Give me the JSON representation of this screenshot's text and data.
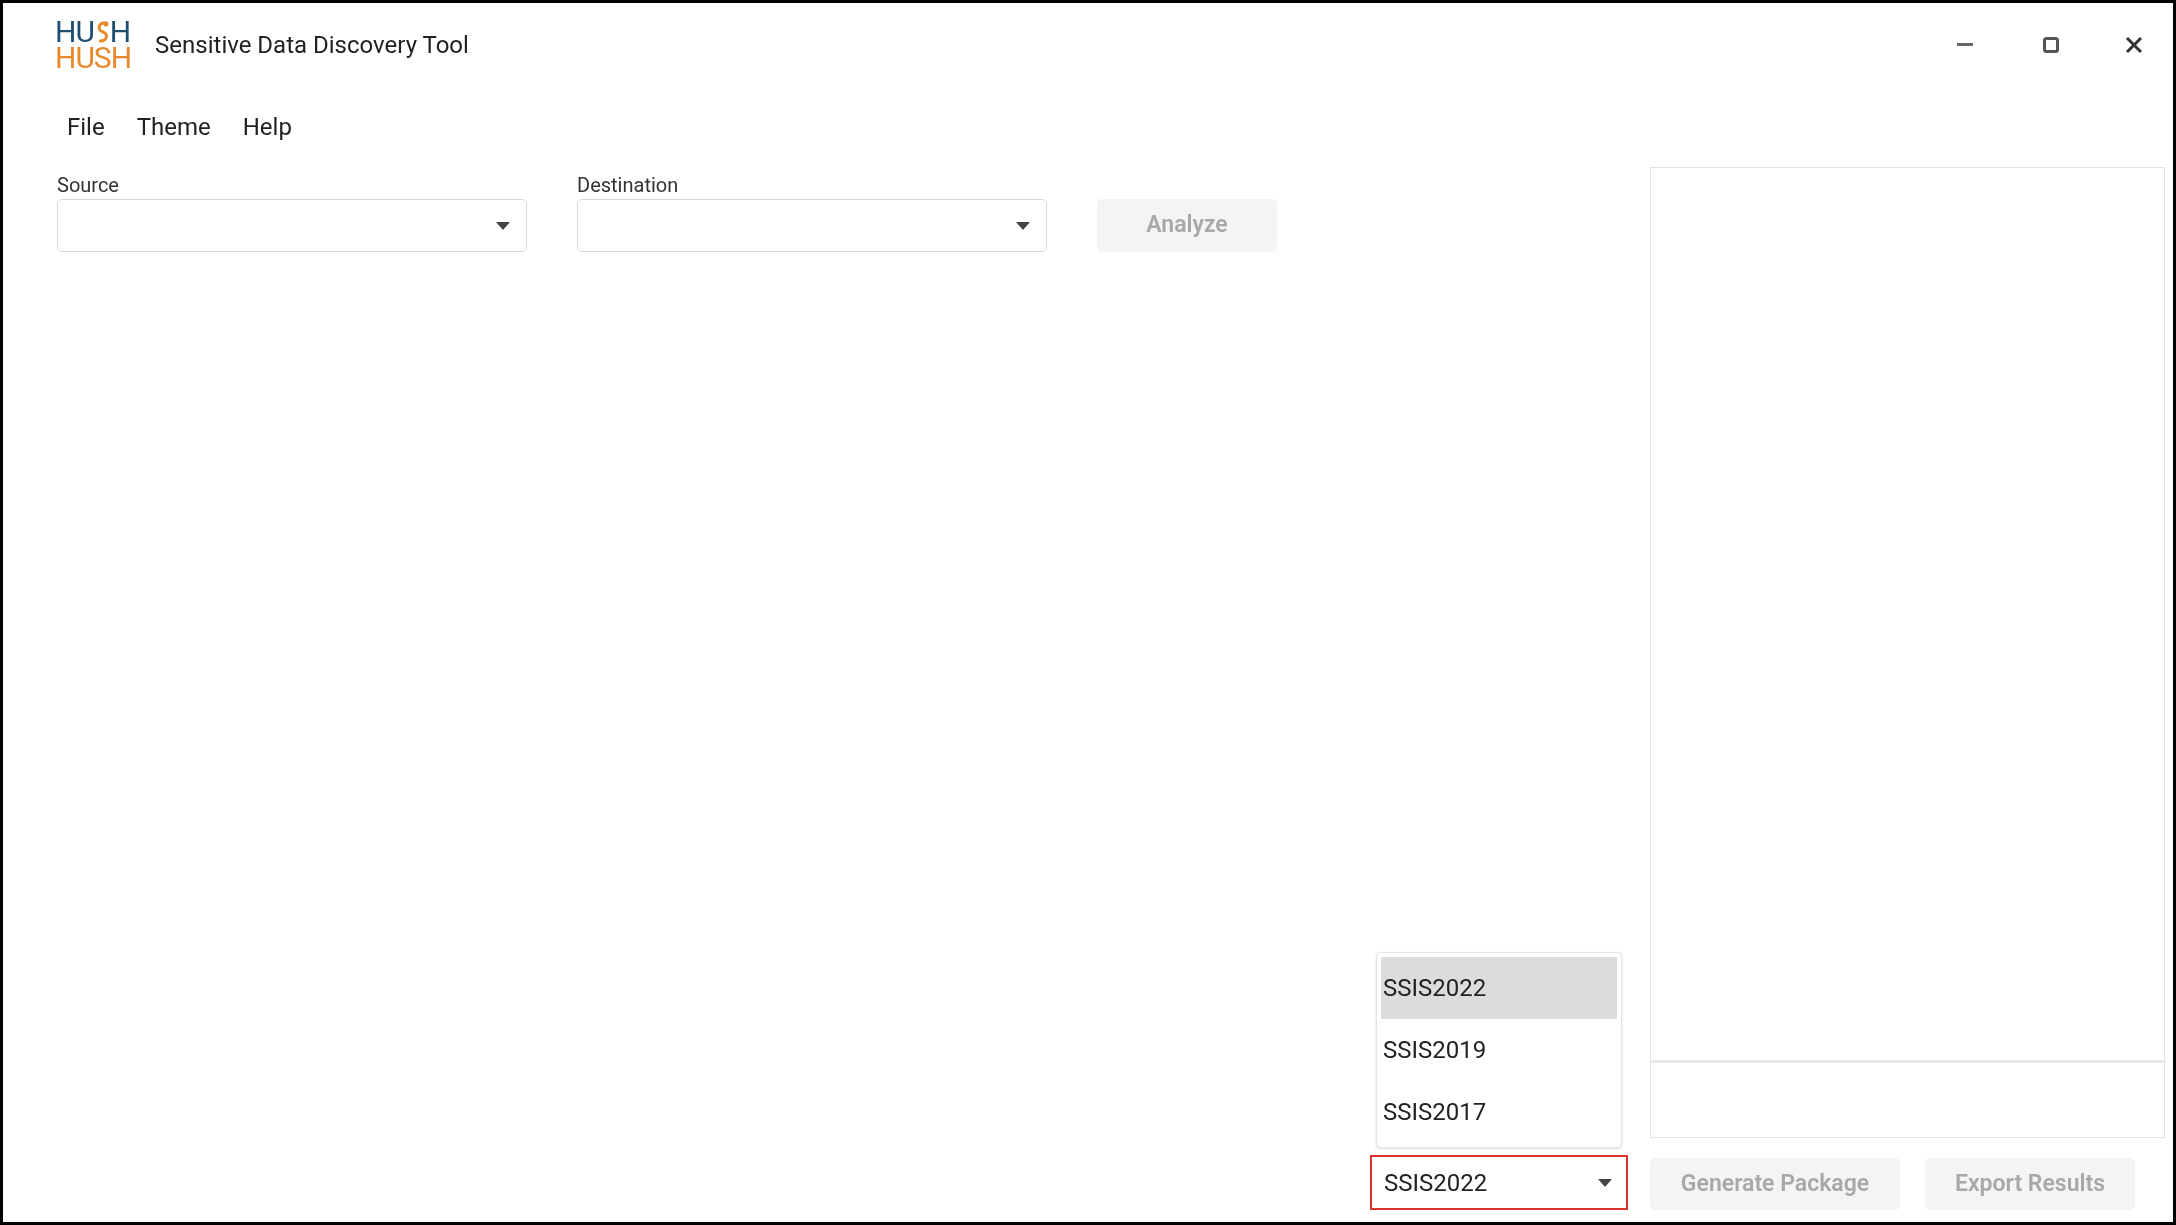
{
  "logo": {
    "top_start": "HU",
    "top_end": "H",
    "bottom": "HUSH"
  },
  "window": {
    "title": "Sensitive Data Discovery Tool"
  },
  "menu": [
    "File",
    "Theme",
    "Help"
  ],
  "source": {
    "label": "Source"
  },
  "destination": {
    "label": "Destination"
  },
  "analyze_button": {
    "label": "Analyze",
    "disabled": true
  },
  "version_select": {
    "value": "SSIS2022",
    "expanded": true,
    "focused": true,
    "options": [
      {
        "label": "SSIS2022",
        "selected": true
      },
      {
        "label": "SSIS2019",
        "selected": false
      },
      {
        "label": "SSIS2017",
        "selected": false
      }
    ]
  },
  "actions": [
    {
      "label": "Generate Package",
      "disabled": true
    },
    {
      "label": "Export Results",
      "disabled": true
    }
  ]
}
